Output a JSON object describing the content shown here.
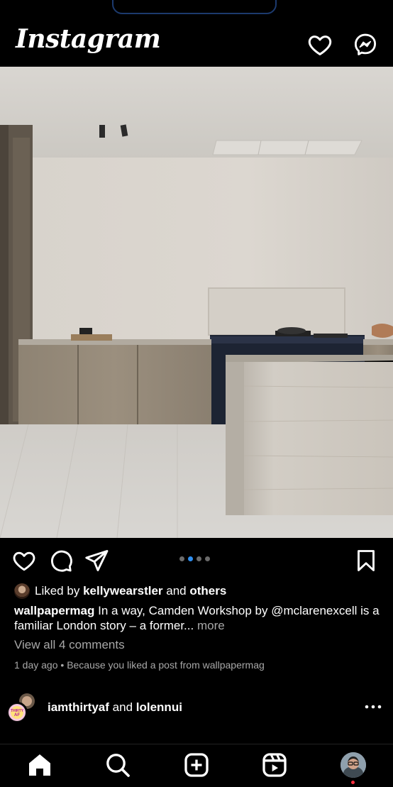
{
  "header": {
    "logo_text": "Instagram",
    "notifications_icon": "heart-icon",
    "messenger_icon": "messenger-icon"
  },
  "post": {
    "image_icon": "kitchen-photo",
    "actions": {
      "like_icon": "heart-outline-icon",
      "comment_icon": "comment-icon",
      "share_icon": "paper-plane-icon",
      "save_icon": "bookmark-icon"
    },
    "carousel": {
      "count": 4,
      "active_index": 1
    },
    "likes": {
      "prefix": "Liked by",
      "user": "kellywearstler",
      "joiner": "and",
      "others": "others"
    },
    "caption": {
      "username": "wallpapermag",
      "text": "In a way, Camden Workshop by @mclarenexcell is a familiar London story – a former...",
      "more_label": "more"
    },
    "view_comments": "View all 4 comments",
    "time_ago": "1 day ago",
    "separator": "•",
    "reason": "Because you liked a post from wallpapermag"
  },
  "next_post": {
    "user1": "iamthirtyaf",
    "joiner": "and",
    "user2": "lolennui",
    "more_icon": "more-dots-icon",
    "avatar_badge": "THIRTY AF"
  },
  "bottom_nav": {
    "home_icon": "home-icon",
    "search_icon": "search-icon",
    "create_icon": "plus-square-icon",
    "reels_icon": "reels-icon",
    "profile_icon": "profile-avatar"
  },
  "colors": {
    "background": "#000000",
    "text": "#ffffff",
    "muted": "#a8a8a8",
    "active_dot": "#2f8ff0",
    "notification_dot": "#ff3040"
  }
}
